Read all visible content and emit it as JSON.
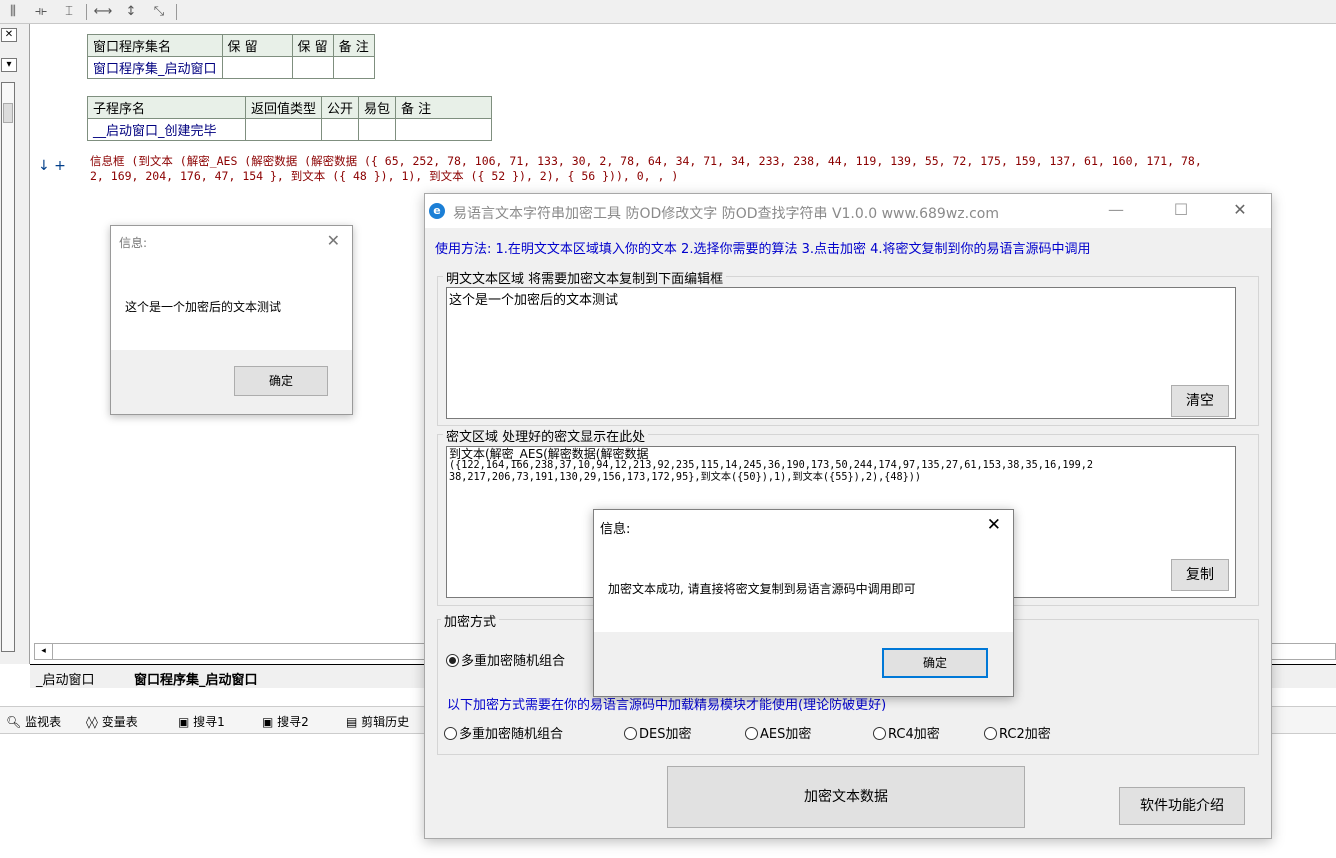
{
  "ide": {
    "toolbar_icons": [
      "align-left-icon",
      "align-center-icon",
      "align-right-icon",
      "fit-width-icon",
      "fit-height-icon",
      "fit-all-icon"
    ],
    "table1": {
      "headers": [
        "窗口程序集名",
        "保 留",
        "保 留",
        "备 注"
      ],
      "row": [
        "窗口程序集_启动窗口",
        "",
        "",
        ""
      ]
    },
    "table2": {
      "headers": [
        "子程序名",
        "返回值类型",
        "公开",
        "易包",
        "备 注"
      ],
      "row": [
        "__启动窗口_创建完毕",
        "",
        "",
        "",
        ""
      ]
    },
    "gutter_marks": "↓ +",
    "code_line1": "信息框 (到文本 (解密_AES (解密数据 (解密数据 ({ 65, 252, 78, 106, 71, 133, 30, 2, 78, 64, 34, 71, 34, 233, 238, 44, 119, 139, 55, 72, 175, 159, 137, 61, 160, 171, 78,",
    "code_line2": "2, 169, 204, 176, 47, 154 }, 到文本 ({ 48 }), 1), 到文本 ({ 52 }), 2), { 56 })), 0, , )",
    "doc_tabs": [
      "_启动窗口",
      "窗口程序集_启动窗口"
    ],
    "panel_items": [
      "监视表",
      "变量表",
      "搜寻1",
      "搜寻2",
      "剪辑历史"
    ]
  },
  "msg_small": {
    "title": "信息:",
    "text": "这个是一个加密后的文本测试",
    "ok": "确定"
  },
  "tool": {
    "title": "易语言文本字符串加密工具 防OD修改文字 防OD查找字符串 V1.0.0   www.689wz.com",
    "usage": "使用方法: 1.在明文文本区域填入你的文本 2.选择你需要的算法 3.点击加密 4.将密文复制到你的易语言源码中调用",
    "plain_group_label": "明文文本区域  将需要加密文本复制到下面编辑框",
    "plain_text": "这个是一个加密后的文本测试",
    "clear_btn": "清空",
    "cipher_group_label": "密文区域  处理好的密文显示在此处",
    "cipher_text_line1": "到文本(解密_AES(解密数据(解密数据",
    "cipher_text_line2": "({122,164,166,238,37,10,94,12,213,92,235,115,14,245,36,190,173,50,244,174,97,135,27,61,153,38,35,16,199,2",
    "cipher_text_line3": "38,217,206,73,191,130,29,156,173,172,95},到文本({50}),1),到文本({55}),2),{48}))",
    "copy_btn": "复制",
    "method_group_label": "加密方式",
    "method_selected": "多重加密随机组合",
    "notice": "以下加密方式需要在你的易语言源码中加载精易模块才能使用(理论防破更好)",
    "radio_options": [
      "多重加密随机组合",
      "DES加密",
      "AES加密",
      "RC4加密",
      "RC2加密"
    ],
    "encrypt_btn": "加密文本数据",
    "intro_btn": "软件功能介绍"
  },
  "msg_main": {
    "title": "信息:",
    "text": "加密文本成功, 请直接将密文复制到易语言源码中调用即可",
    "ok": "确定"
  }
}
